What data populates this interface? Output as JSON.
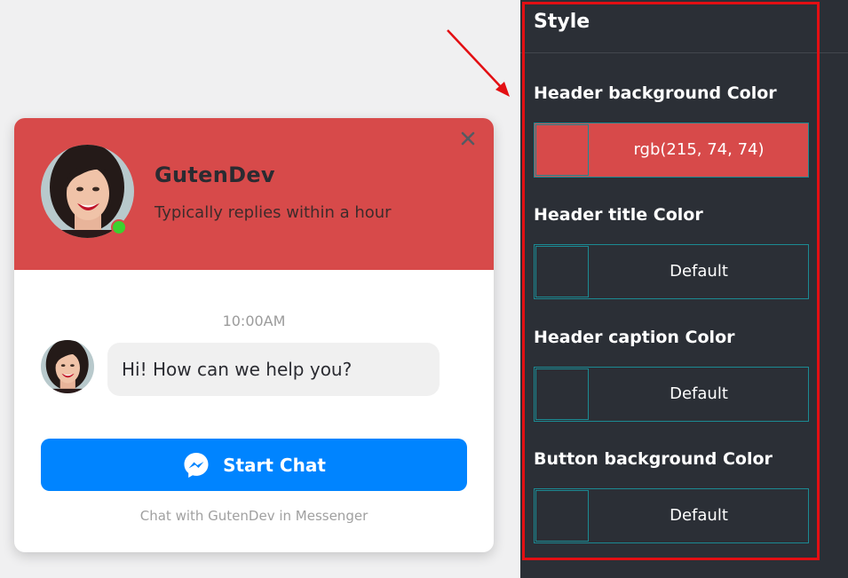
{
  "widget": {
    "header_title": "GutenDev",
    "header_caption": "Typically replies within a hour",
    "header_color": "#d74a4a",
    "online_status": "online",
    "timestamp": "10:00AM",
    "message": "Hi! How can we help you?",
    "start_button_label": "Start Chat",
    "start_button_color": "#0084ff",
    "footer_note": "Chat with GutenDev in Messenger",
    "icons": {
      "close": "close-icon",
      "messenger": "messenger-icon"
    }
  },
  "panel": {
    "heading": "Style",
    "highlight_color": "#e30f13",
    "fields": [
      {
        "label": "Header background Color",
        "value": "rgb(215, 74, 74)",
        "color": "#d74a4a"
      },
      {
        "label": "Header title Color",
        "value": "Default",
        "color": ""
      },
      {
        "label": "Header caption Color",
        "value": "Default",
        "color": ""
      },
      {
        "label": "Button background Color",
        "value": "Default",
        "color": ""
      }
    ]
  }
}
